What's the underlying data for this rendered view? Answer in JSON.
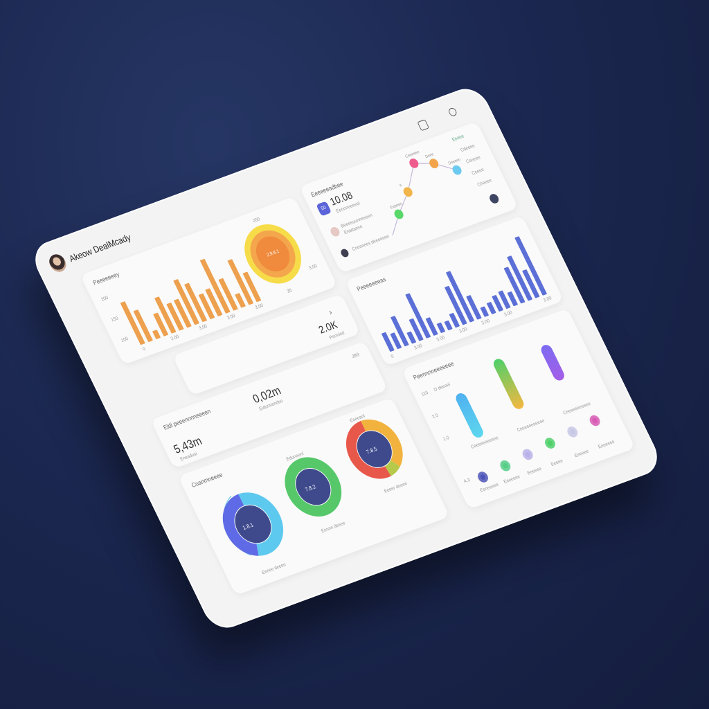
{
  "header": {
    "title": "Akeow DealMcady",
    "icons": [
      "calendar-icon",
      "search-icon"
    ]
  },
  "colors": {
    "background": "#1b2750",
    "orange": "#eda04e",
    "blue": "#5b6fd6",
    "donut_center": "#3e4a8c"
  },
  "panel_orange": {
    "title": "Peeeeeeey",
    "y_ticks": [
      "200",
      "150",
      "100"
    ],
    "x_ticks": [
      "0",
      "3.00",
      "3.00",
      "3.00",
      "3.00"
    ],
    "donut_value": "2.9.8.1",
    "donut_labels": [
      "200",
      "3.00",
      "35"
    ]
  },
  "panel_kpi_small": {
    "value": "2.0K",
    "caption": "Pennied"
  },
  "panel_kpis": {
    "title": "Eldi peeennnneeeen",
    "kpi1": {
      "value": "0,02m",
      "caption": "Eidunnendee"
    },
    "kpi2": {
      "value": "5,43m",
      "caption": "Eneadusi"
    },
    "corner": "2B9"
  },
  "panel_donuts": {
    "title": "Coanmneeee",
    "donuts": [
      {
        "value": "1.8.1",
        "caption": "Eenee deeen"
      },
      {
        "value": "7.8.2",
        "caption": "Eennn deeee",
        "top_label": "Eduneenl"
      },
      {
        "value": "7.8.5",
        "caption": "Eeeer deeee",
        "top_label": "Eeeeanl"
      }
    ]
  },
  "panel_line": {
    "title": "Eeeeeeadbee",
    "value": "10.08",
    "value_caption": "Eennneeeeel",
    "badge": "50",
    "user_line": "Beeeeuunneeeen",
    "user_sub": "Enadanne",
    "footer": "Cneeeees deeeeeee",
    "legend": "Eeeee",
    "right_labels": [
      "Cdeeee",
      "Ceeeee",
      "Ceeee",
      "Cheeee"
    ],
    "node_labels": [
      "Eepeen",
      "a",
      "Ceeeeee",
      "Deee",
      "Deeeen"
    ]
  },
  "panel_blue": {
    "title": "Peeeeeeeas",
    "x_ticks": [
      "0",
      "3.00",
      "3.00",
      "3.00",
      "3.00",
      "3.00",
      "3.00"
    ]
  },
  "panel_pills": {
    "title": "Peennnneeeeeee",
    "y_ticks": [
      "110",
      "2.0",
      "1.0"
    ],
    "top_label": "O deeeel",
    "pill_captions": [
      "Ceeeeeeeeeee",
      "Ceeeeeeeeeee",
      "Ceeeeeeeeeee"
    ],
    "row_label": "A.3",
    "circle_captions": [
      "Eeneeeee",
      "Eeeeeee",
      "Eeeeee",
      "Eeeee",
      "Eeeeee",
      "Eeeeeee"
    ]
  },
  "chart_data": [
    {
      "type": "bar",
      "title": "Peeeeeeey",
      "values": [
        95,
        70,
        18,
        50,
        80,
        60,
        62,
        100,
        85,
        55,
        60,
        120,
        70,
        30,
        100,
        65
      ],
      "ylim": [
        0,
        130
      ]
    },
    {
      "type": "pie",
      "values": [
        70,
        20,
        10
      ],
      "colors": [
        "#f08a3c",
        "#f4a64c",
        "#f7dc4a"
      ]
    },
    {
      "type": "line",
      "values": [
        20,
        45,
        80,
        70,
        50
      ],
      "colors": [
        "#5ad86a",
        "#f2b54a",
        "#ee5b8c",
        "#f2a44a",
        "#6ccaf0"
      ]
    },
    {
      "type": "bar",
      "title": "Peeeeeeeas",
      "values": [
        30,
        25,
        48,
        18,
        35,
        72,
        28,
        15,
        14,
        22,
        62,
        82,
        38,
        15,
        18,
        25,
        28,
        22,
        58,
        72,
        45,
        95
      ],
      "ylim": [
        0,
        100
      ]
    },
    {
      "type": "pie",
      "values": [
        55,
        45
      ],
      "colors": [
        "#5ec9ef",
        "#5f6be6"
      ]
    },
    {
      "type": "pie",
      "values": [
        100
      ],
      "colors": [
        "#56c86a"
      ]
    },
    {
      "type": "pie",
      "values": [
        40,
        8,
        52
      ],
      "colors": [
        "#f2b33e",
        "#b7c94a",
        "#e8584a"
      ]
    },
    {
      "type": "bar",
      "values": [
        75,
        85,
        60
      ],
      "colors": [
        [
          "#4fb0f0",
          "#5dd7ee"
        ],
        [
          "#4fd06a",
          "#f4b740"
        ],
        [
          "#7c6bf0",
          "#a35ee8"
        ]
      ],
      "ylim": [
        0,
        110
      ]
    }
  ],
  "circles": [
    "#4e55b8",
    "#55cd86",
    "#b8b2e8",
    "#4fd06a",
    "#c7c7e6",
    "#d85ab4"
  ]
}
